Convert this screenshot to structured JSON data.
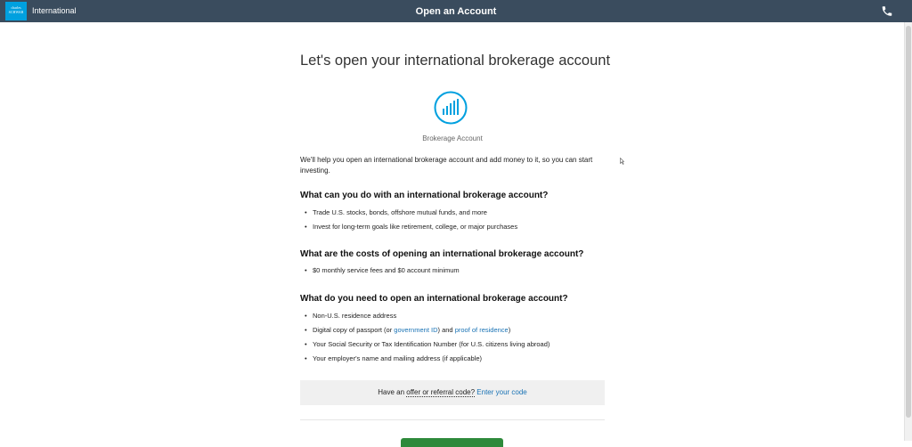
{
  "header": {
    "logo_line1": "charles",
    "logo_line2": "SCHWAB",
    "brand_label": "International",
    "title": "Open an Account",
    "bg_color": "#3a4c5e"
  },
  "main": {
    "heading": "Let's open your international brokerage account",
    "account_icon": "bar-chart-icon",
    "account_label": "Brokerage Account",
    "intro": "We'll help you open an international brokerage account and add money to it, so you can start investing."
  },
  "sections": [
    {
      "heading": "What can you do with an international brokerage account?",
      "items": [
        "Trade U.S. stocks, bonds, offshore mutual funds, and more",
        "Invest for long-term goals like retirement, college, or major purchases"
      ]
    },
    {
      "heading": "What are the costs of opening an international brokerage account?",
      "items": [
        "$0 monthly service fees and $0 account minimum"
      ]
    },
    {
      "heading": "What do you need to open an international brokerage account?",
      "items": {
        "residence": "Non-U.S. residence address",
        "passport_prefix": "Digital copy of passport (or ",
        "government_id_link": "government ID",
        "passport_middle": ") and ",
        "proof_link": "proof of residence",
        "ssn": "Your Social Security or Tax Identification Number (for U.S. citizens living abroad)",
        "employer": "Your employer's name and mailing address (if applicable)"
      }
    }
  ],
  "offer": {
    "prefix": "Have an ",
    "dotted_text": "offer or referral code?",
    "link": "Enter your code"
  },
  "colors": {
    "accent": "#00a0df",
    "link": "#1a73b5",
    "button": "#2e8a3b"
  }
}
